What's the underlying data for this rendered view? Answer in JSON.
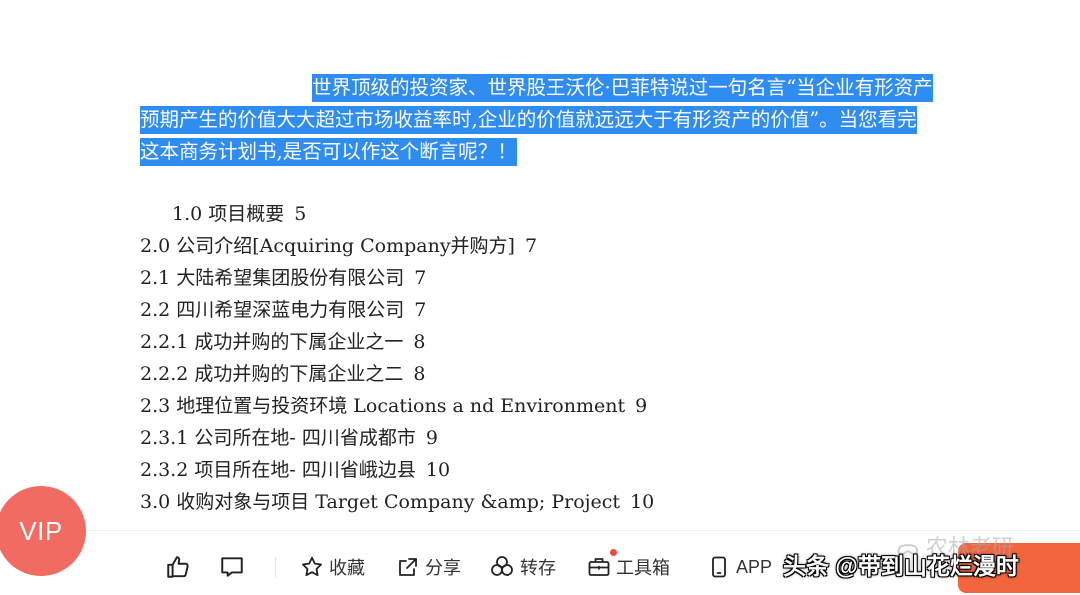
{
  "paragraph": {
    "line1": "世界顶级的投资家、世界股王沃伦·巴菲特说过一句名言“当企业有形资产",
    "line2": "预期产生的价值大大超过市场收益率时,企业的价值就远远大于有形资产的价值”。当您看完",
    "line3": "这本商务计划书,是否可以作这个断言呢？！"
  },
  "toc": [
    {
      "text": "1.0  项目概要",
      "page": "5"
    },
    {
      "text": "2.0  公司介绍[Acquiring  Company并购方]",
      "page": "7"
    },
    {
      "text": "2.1 大陆希望集团股份有限公司",
      "page": "7"
    },
    {
      "text": "2.2 四川希望深蓝电力有限公司",
      "page": "7"
    },
    {
      "text": "2.2.1 成功并购的下属企业之一",
      "page": "8"
    },
    {
      "text": "2.2.2 成功并购的下属企业之二",
      "page": "8"
    },
    {
      "text": "2.3 地理位置与投资环境 Locations  a  nd  Environment",
      "page": "9"
    },
    {
      "text": "2.3.1 公司所在地- 四川省成都市",
      "page": "9"
    },
    {
      "text": "2.3.2 项目所在地- 四川省峨边县",
      "page": "10"
    },
    {
      "text": "3.0  收购对象与项目  Target Company &amp; Project",
      "page": "10"
    }
  ],
  "vip": {
    "label": "VIP"
  },
  "toolbar": {
    "like_icon": "thumbs-up-icon",
    "comment_icon": "comment-icon",
    "collect_label": "收藏",
    "share_label": "分享",
    "save_label": "转存",
    "toolbox_label": "工具箱",
    "app_label": "APP"
  },
  "watermark": {
    "text": "头条 @带到山花烂漫时",
    "faint_text": "农林老研"
  },
  "colors": {
    "highlight": "#2f8cf0",
    "vip": "#f26b63",
    "cta": "#f2653d"
  }
}
